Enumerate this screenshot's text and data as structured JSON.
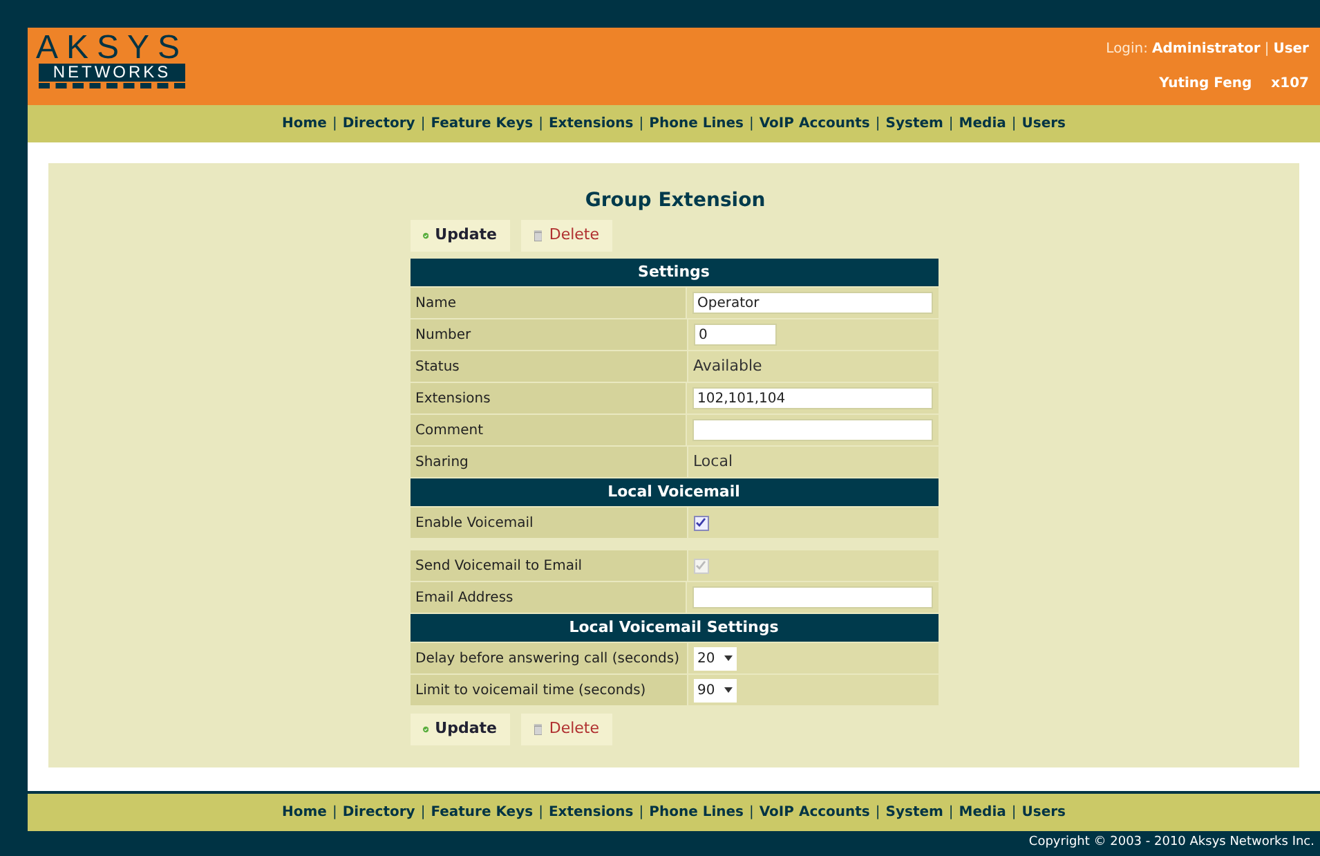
{
  "logo": {
    "top": "AKSYS",
    "bottom": "NETWORKS"
  },
  "login": {
    "label": "Login:",
    "role": "Administrator",
    "separator": "|",
    "link": "User",
    "user": "Yuting Feng",
    "extension": "x107"
  },
  "nav": {
    "separator": "|",
    "items": [
      "Home",
      "Directory",
      "Feature Keys",
      "Extensions",
      "Phone Lines",
      "VoIP Accounts",
      "System",
      "Media",
      "Users"
    ]
  },
  "page_title": "Group Extension",
  "top_buttons": [
    {
      "kind": "update",
      "label": "Update"
    },
    {
      "kind": "delete",
      "label": "Delete"
    }
  ],
  "form": [
    {
      "kind": "header",
      "label": "Settings"
    },
    {
      "kind": "input",
      "label": "Name",
      "value": "Operator"
    },
    {
      "kind": "short_input",
      "label": "Number",
      "value": "0"
    },
    {
      "kind": "text",
      "label": "Status",
      "value": "Available"
    },
    {
      "kind": "input",
      "label": "Extensions",
      "value": "102,101,104"
    },
    {
      "kind": "input",
      "label": "Comment"
    },
    {
      "kind": "text",
      "label": "Sharing",
      "value": "Local"
    },
    {
      "kind": "header",
      "label": "Local Voicemail"
    },
    {
      "kind": "checkbox",
      "label": "Enable Voicemail",
      "checked": true,
      "disabled": false
    },
    {
      "kind": "spacer"
    },
    {
      "kind": "checkbox",
      "label": "Send Voicemail to Email",
      "checked": true,
      "disabled": true
    },
    {
      "kind": "input",
      "label": "Email Address"
    },
    {
      "kind": "header",
      "label": "Local Voicemail Settings"
    },
    {
      "kind": "select",
      "label": "Delay before answering call (seconds)",
      "value": "20"
    },
    {
      "kind": "select",
      "label": "Limit to voicemail time (seconds)",
      "value": "90"
    }
  ],
  "bottom_buttons": [
    {
      "kind": "update",
      "label": "Update"
    },
    {
      "kind": "delete",
      "label": "Delete"
    }
  ],
  "footer_nav": {
    "separator": "|",
    "items": [
      "Home",
      "Directory",
      "Feature Keys",
      "Extensions",
      "Phone Lines",
      "VoIP Accounts",
      "System",
      "Media",
      "Users"
    ]
  },
  "copyright": "Copyright © 2003 - 2010 Aksys Networks Inc."
}
